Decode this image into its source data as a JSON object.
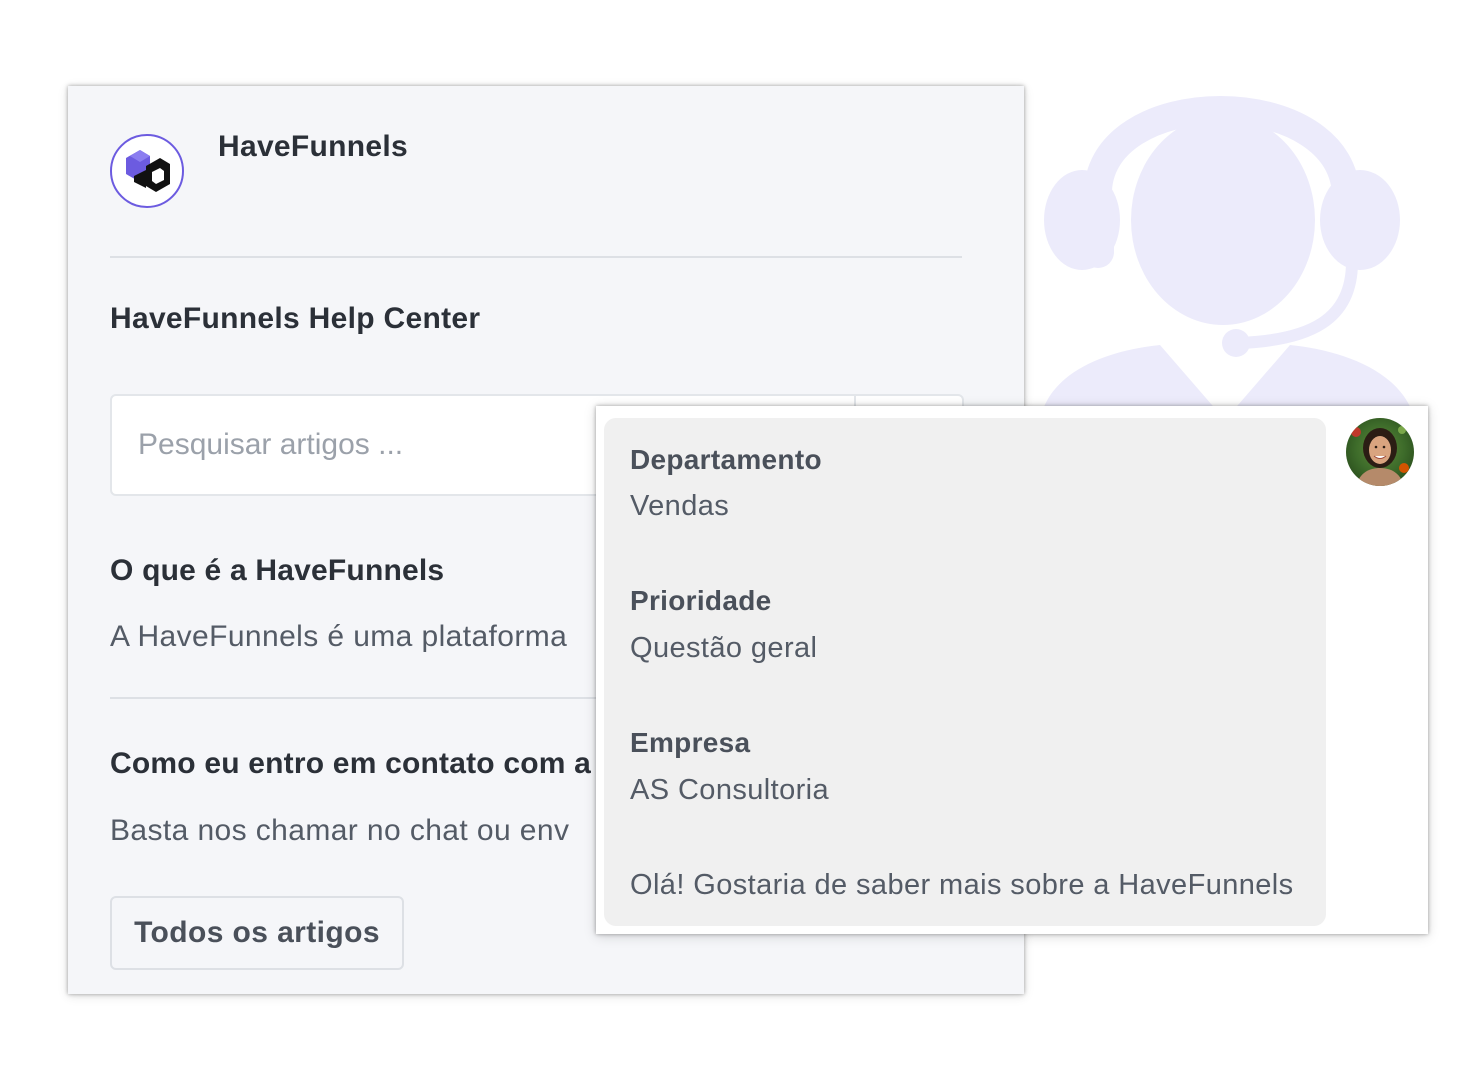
{
  "brand": {
    "name": "HaveFunnels",
    "accent_color": "#6c5be0",
    "logo_icon": "cube-logo-icon"
  },
  "help_center": {
    "title": "HaveFunnels Help Center",
    "search": {
      "placeholder": "Pesquisar artigos ...",
      "value": "",
      "icon": "search-icon"
    },
    "articles": [
      {
        "title": "O que é a HaveFunnels",
        "excerpt": "A HaveFunnels é uma plataforma"
      },
      {
        "title": "Como eu entro em contato com a",
        "excerpt": "Basta nos chamar no chat ou env"
      }
    ],
    "all_articles_label": "Todos os artigos"
  },
  "chat_message": {
    "fields": [
      {
        "label": "Departamento",
        "value": "Vendas"
      },
      {
        "label": "Prioridade",
        "value": "Questão geral"
      },
      {
        "label": "Empresa",
        "value": "AS Consultoria"
      }
    ],
    "message": "Olá! Gostaria de saber mais sobre a HaveFunnels",
    "avatar_icon": "user-avatar",
    "bubble_color": "#f0f0f0"
  },
  "background": {
    "icon": "support-agent-headset-icon",
    "color": "#ecebfb"
  }
}
